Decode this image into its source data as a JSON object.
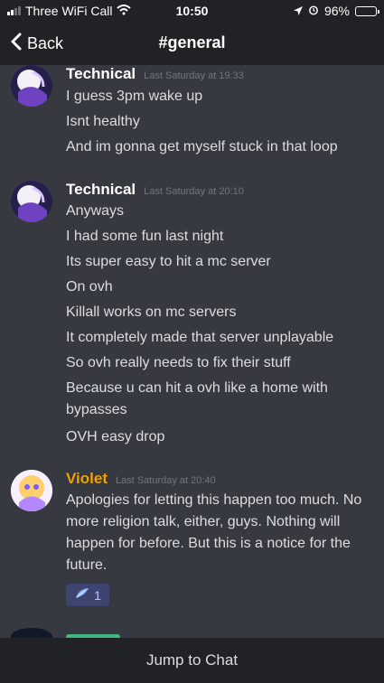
{
  "status": {
    "carrier": "Three WiFi Call",
    "time": "10:50",
    "battery": "96%",
    "battery_level": 0.96
  },
  "nav": {
    "back_label": "Back",
    "title": "#general"
  },
  "messages": [
    {
      "author": "Technical",
      "timestamp": "Last Saturday at 19:33",
      "lines": [
        "I guess 3pm wake up",
        "Isnt healthy",
        "And im gonna get myself stuck in that loop"
      ]
    },
    {
      "author": "Technical",
      "timestamp": "Last Saturday at 20:10",
      "lines": [
        "Anyways",
        "I had some fun last night",
        "Its super easy to hit a mc server",
        "On ovh",
        "Killall works on mc servers",
        "It completely made that server unplayable",
        "So ovh really needs to fix their stuff",
        "Because u can hit a ovh like a home with bypasses",
        "OVH easy drop"
      ]
    },
    {
      "author": "Violet",
      "author_color": "#f0a000",
      "timestamp": "Last Saturday at 20:40",
      "lines": [
        "Apologies for letting this happen too much. No more religion talk, either, guys. Nothing will happen for before. But this is a notice for the future."
      ],
      "reaction": {
        "icon": "feather-icon",
        "count": "1"
      }
    }
  ],
  "footer": {
    "jump_label": "Jump to Chat"
  }
}
